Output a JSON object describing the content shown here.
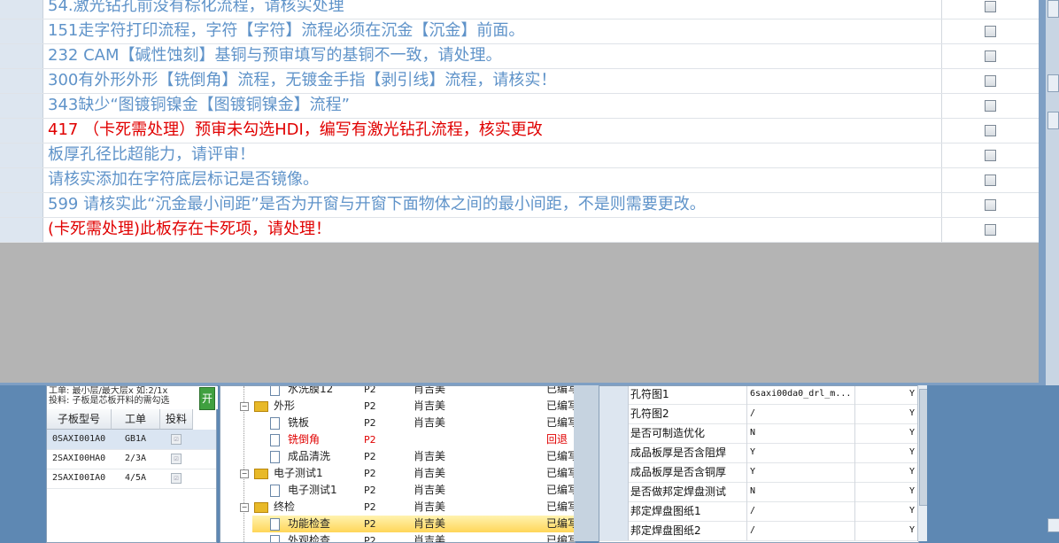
{
  "check_messages": [
    {
      "text": "54.激光钻孔前没有棕化流程，请核实处理",
      "critical": false
    },
    {
      "text": "151走字符打印流程，字符【字符】流程必须在沉金【沉金】前面。",
      "critical": false
    },
    {
      "text": "232 CAM【碱性蚀刻】基铜与预审填写的基铜不一致，请处理。",
      "critical": false
    },
    {
      "text": "300有外形外形【铣倒角】流程，无镀金手指【剥引线】流程，请核实！",
      "critical": false
    },
    {
      "text": "343缺少“图镀铜镍金【图镀铜镍金】流程”",
      "critical": false
    },
    {
      "text": "417 （卡死需处理）预审未勾选HDI，编写有激光钻孔流程，核实更改",
      "critical": true
    },
    {
      "text": "板厚孔径比超能力，请评审！",
      "critical": false
    },
    {
      "text": "请核实添加在字符底层标记是否镜像。",
      "critical": false
    },
    {
      "text": "599 请核实此“沉金最小间距”是否为开窗与开窗下面物体之间的最小间距，不是则需要更改。",
      "critical": false
    },
    {
      "text": "(卡死需处理)此板存在卡死项，请处理！",
      "critical": true
    }
  ],
  "left_panel": {
    "info_line1": "工单: 最小层/最大层x 如:2/1x",
    "info_line2": "投料: 子板是芯板开料的需勾选",
    "open_button": "开",
    "headers": [
      "子板型号",
      "工单",
      "投料"
    ],
    "rows": [
      {
        "model": "0SAXI001A0",
        "order": "GB1A",
        "feed": "☑",
        "selected": true
      },
      {
        "model": "2SAXI00HA0",
        "order": "2/3A",
        "feed": "☑",
        "selected": false
      },
      {
        "model": "2SAXI00IA0",
        "order": "4/5A",
        "feed": "☑",
        "selected": false
      }
    ]
  },
  "process_tree": [
    {
      "name": "水洗膜12",
      "level": "P2",
      "person": "肖吉美",
      "status": "已编写",
      "kind": "doc",
      "depth": 2,
      "red": false,
      "selected": false,
      "partial": true
    },
    {
      "name": "外形",
      "level": "P2",
      "person": "肖吉美",
      "status": "已编写",
      "kind": "folder",
      "depth": 1,
      "red": false,
      "selected": false
    },
    {
      "name": "铣板",
      "level": "P2",
      "person": "肖吉美",
      "status": "已编写",
      "kind": "doc",
      "depth": 2,
      "red": false,
      "selected": false
    },
    {
      "name": "铣倒角",
      "level": "P2",
      "person": "",
      "status": "回退",
      "kind": "doc",
      "depth": 2,
      "red": true,
      "selected": false
    },
    {
      "name": "成品清洗",
      "level": "P2",
      "person": "肖吉美",
      "status": "已编写",
      "kind": "doc",
      "depth": 2,
      "red": false,
      "selected": false
    },
    {
      "name": "电子测试1",
      "level": "P2",
      "person": "肖吉美",
      "status": "已编写",
      "kind": "folder",
      "depth": 1,
      "red": false,
      "selected": false
    },
    {
      "name": "电子测试1",
      "level": "P2",
      "person": "肖吉美",
      "status": "已编写",
      "kind": "doc",
      "depth": 2,
      "red": false,
      "selected": false
    },
    {
      "name": "终检",
      "level": "P2",
      "person": "肖吉美",
      "status": "已编写",
      "kind": "folder",
      "depth": 1,
      "red": false,
      "selected": false
    },
    {
      "name": "功能检查",
      "level": "P2",
      "person": "肖吉美",
      "status": "已编写",
      "kind": "doc",
      "depth": 2,
      "red": false,
      "selected": true
    },
    {
      "name": "外观检查",
      "level": "P2",
      "person": "肖吉美",
      "status": "已编写",
      "kind": "doc",
      "depth": 2,
      "red": false,
      "selected": false
    }
  ],
  "properties": [
    {
      "key": "孔符图1",
      "value": "6saxi00da0_drl_m...",
      "flag": "Y"
    },
    {
      "key": "孔符图2",
      "value": "/",
      "flag": "Y"
    },
    {
      "key": "是否可制造优化",
      "value": "N",
      "flag": "Y"
    },
    {
      "key": "成品板厚是否含阻焊",
      "value": "Y",
      "flag": "Y"
    },
    {
      "key": "成品板厚是否含铜厚",
      "value": "Y",
      "flag": "Y"
    },
    {
      "key": "是否做邦定焊盘测试",
      "value": "N",
      "flag": "Y"
    },
    {
      "key": "邦定焊盘图纸1",
      "value": "/",
      "flag": "Y"
    },
    {
      "key": "邦定焊盘图纸2",
      "value": "/",
      "flag": "Y"
    }
  ],
  "colors": {
    "normal_text": "#5f93c9",
    "critical_text": "#e00000",
    "selection": "#ffd659"
  }
}
